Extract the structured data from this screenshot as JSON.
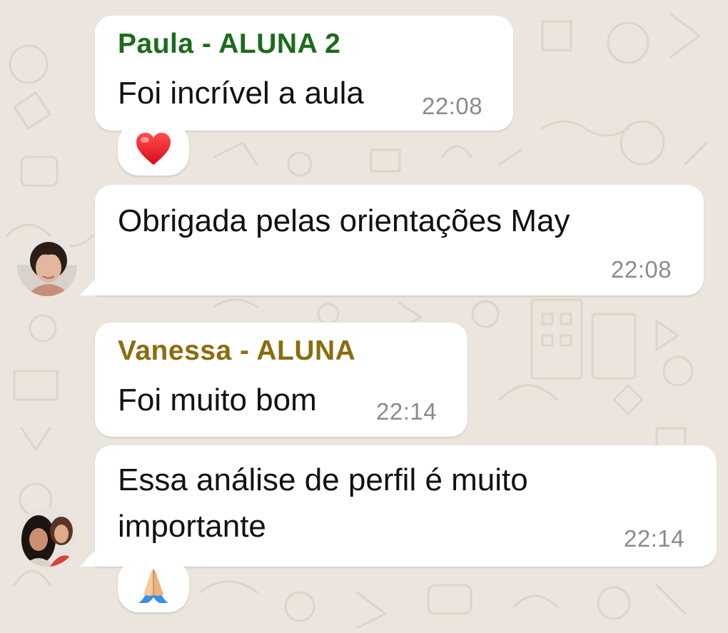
{
  "colors": {
    "background": "#ece5dd",
    "bubble": "#ffffff",
    "sender_paula": "#1c6b1c",
    "sender_vanessa": "#8a6d0f",
    "timestamp": "#8b8b8b"
  },
  "messages": [
    {
      "sender": "Paula - ALUNA 2",
      "text": "Foi incrível a aula",
      "time": "22:08",
      "reaction": "heart-emoji"
    },
    {
      "text": "Obrigada pelas orientações May",
      "time": "22:08",
      "avatar": "paula-avatar"
    },
    {
      "sender": "Vanessa - ALUNA",
      "text": "Foi muito bom",
      "time": "22:14"
    },
    {
      "text_line1": "Essa análise de perfil é muito",
      "text_line2": "importante",
      "time": "22:14",
      "avatar": "vanessa-avatar",
      "reaction": "praying-hands-emoji"
    }
  ]
}
